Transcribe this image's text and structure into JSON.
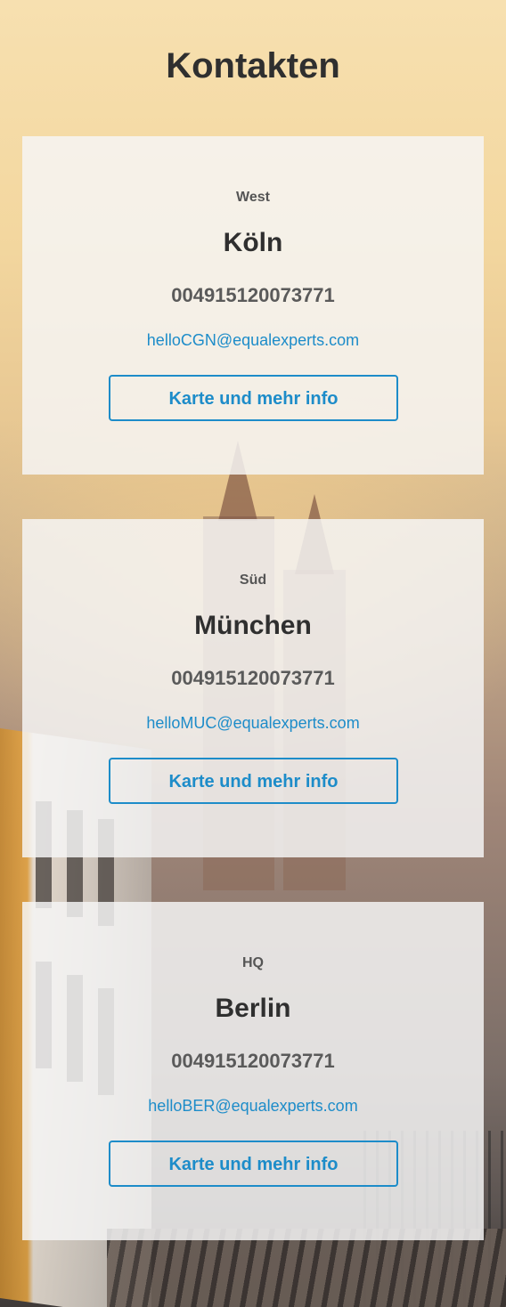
{
  "page": {
    "title": "Kontakten"
  },
  "contacts": [
    {
      "region": "West",
      "city": "Köln",
      "phone": "004915120073771",
      "email": "helloCGN@equalexperts.com",
      "button_label": "Karte und mehr info"
    },
    {
      "region": "Süd",
      "city": "München",
      "phone": "004915120073771",
      "email": "helloMUC@equalexperts.com",
      "button_label": "Karte und mehr info"
    },
    {
      "region": "HQ",
      "city": "Berlin",
      "phone": "004915120073771",
      "email": "helloBER@equalexperts.com",
      "button_label": "Karte und mehr info"
    }
  ],
  "colors": {
    "accent": "#1d8cc9",
    "heading": "#2f2f2f",
    "card_background": "#f6f6f6"
  }
}
